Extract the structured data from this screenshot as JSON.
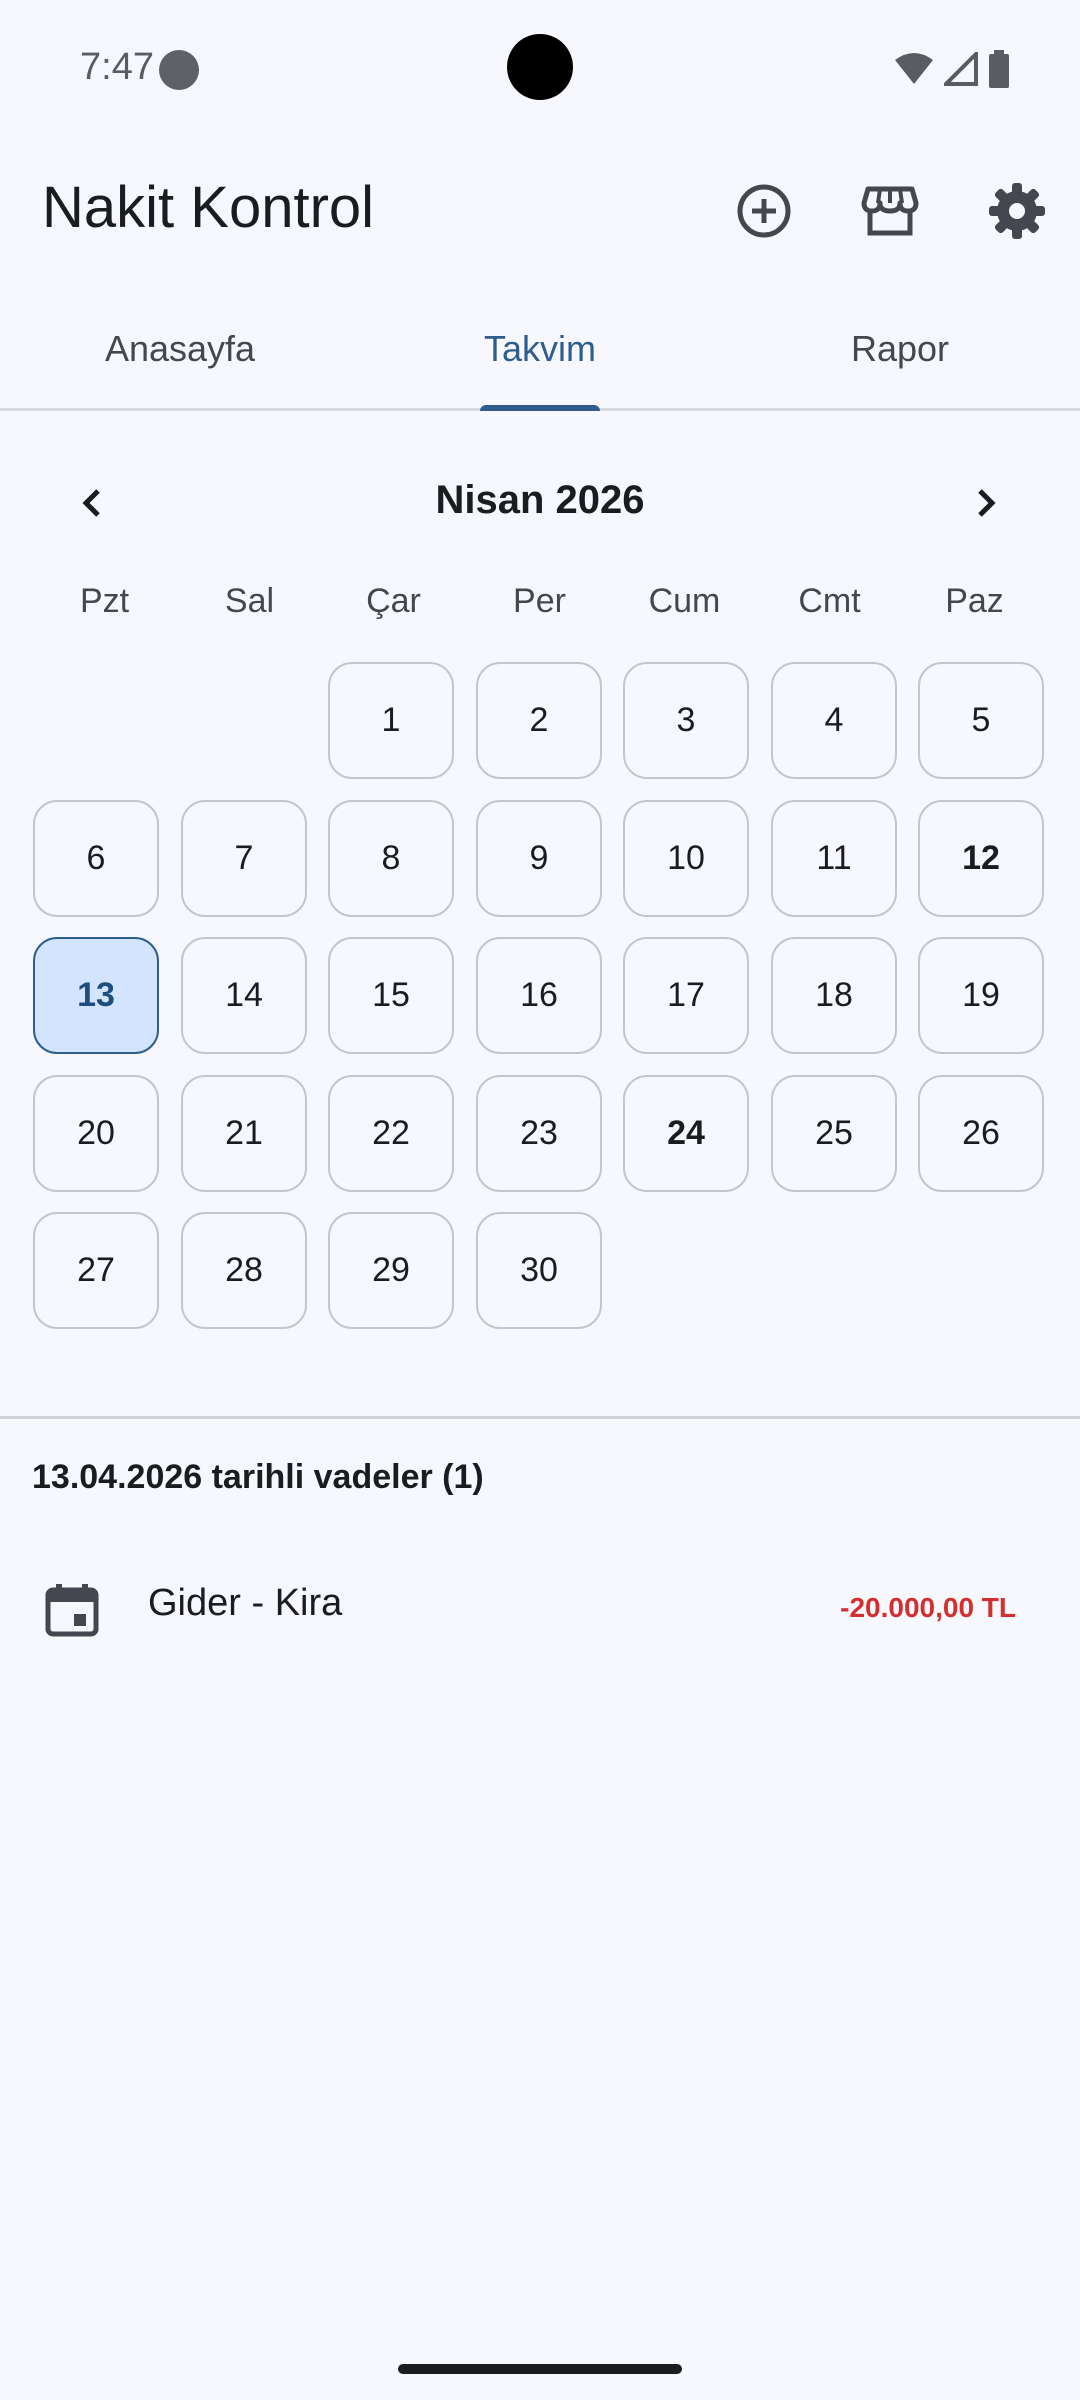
{
  "status_bar": {
    "time": "7:47"
  },
  "app_bar": {
    "title": "Nakit Kontrol",
    "actions": [
      "add-circle-icon",
      "store-icon",
      "settings-icon"
    ]
  },
  "tabs": [
    {
      "label": "Anasayfa"
    },
    {
      "label": "Takvim"
    },
    {
      "label": "Rapor"
    }
  ],
  "calendar": {
    "month_title": "Nisan 2026",
    "weekdays": [
      "Pzt",
      "Sal",
      "Çar",
      "Per",
      "Cum",
      "Cmt",
      "Paz"
    ],
    "first_weekday_index": 2,
    "days_in_month": 30,
    "selected_day": 13,
    "bold_days": [
      12,
      24
    ]
  },
  "due": {
    "title": "13.04.2026 tarihli vadeler (1)",
    "items": [
      {
        "label": "Gider - Kira",
        "amount": "-20.000,00 TL",
        "icon": "calendar-icon"
      }
    ]
  },
  "colors": {
    "background": "#f7f8fe",
    "accent": "#2f5d8e",
    "selected_fill": "#d3e4ff",
    "negative": "#d32f2f"
  }
}
